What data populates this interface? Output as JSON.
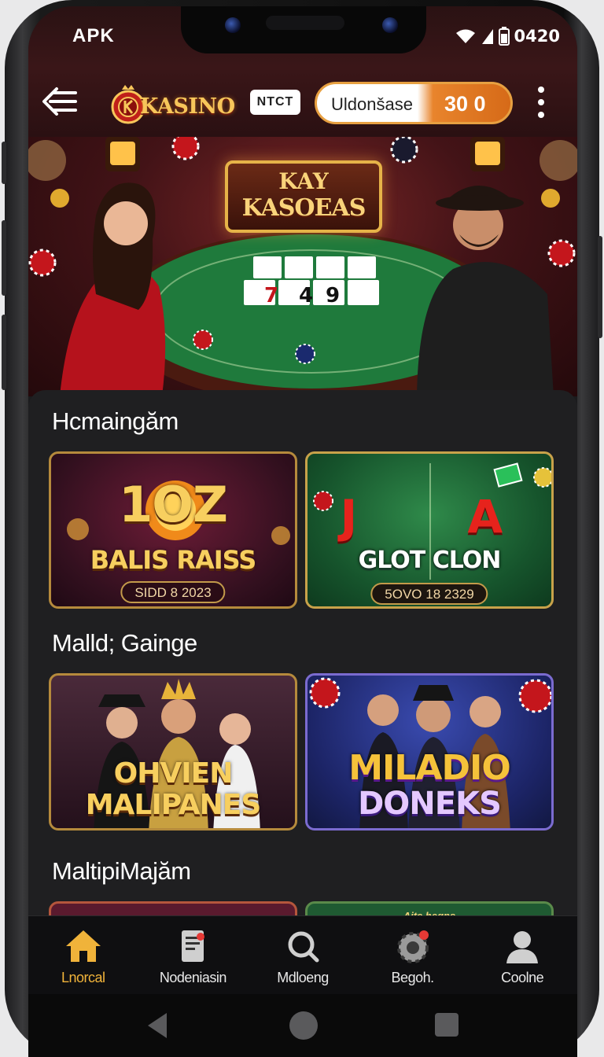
{
  "status_bar": {
    "carrier": "APK",
    "time": "0420"
  },
  "header": {
    "logo_text": "KASINO",
    "tag": "NTCT",
    "balance_label": "Uldonšase",
    "balance_value": "30 0"
  },
  "hero": {
    "title_line1": "KAY",
    "title_line2": "KASOEAS"
  },
  "sections": [
    {
      "title": "Hcmaingăm",
      "cards": [
        {
          "title_top": "1OZ",
          "title_bottom": "BALIS RAISS",
          "badge": "SIDD 8 2023"
        },
        {
          "title_top": "J A",
          "title_bottom": "GLOT  CLON",
          "badge": "5OVO 18 2329"
        }
      ]
    },
    {
      "title": "Malld; Gainge",
      "cards": [
        {
          "title_top": "OHVIEN",
          "title_bottom": "MALIPANES"
        },
        {
          "title_top": "MILADIO",
          "title_bottom": "DONEKS"
        }
      ]
    },
    {
      "title": "MaltipiMajăm",
      "cards": [
        {
          "title_top": ""
        },
        {
          "title_top": "Aite hegns"
        }
      ]
    }
  ],
  "bottom_nav": [
    {
      "label": "Lnorcal",
      "icon": "home-icon",
      "active": true
    },
    {
      "label": "Nodeniasin",
      "icon": "document-icon",
      "active": false
    },
    {
      "label": "Mdloeng",
      "icon": "search-icon",
      "active": false
    },
    {
      "label": "Begoh.",
      "icon": "chip-icon",
      "active": false
    },
    {
      "label": "Coolne",
      "icon": "user-icon",
      "active": false
    }
  ],
  "colors": {
    "accent_gold": "#f0b33a",
    "header_bg": "#3a1618",
    "panel_bg": "#1f1f21",
    "balance_orange": "#d66a18"
  }
}
